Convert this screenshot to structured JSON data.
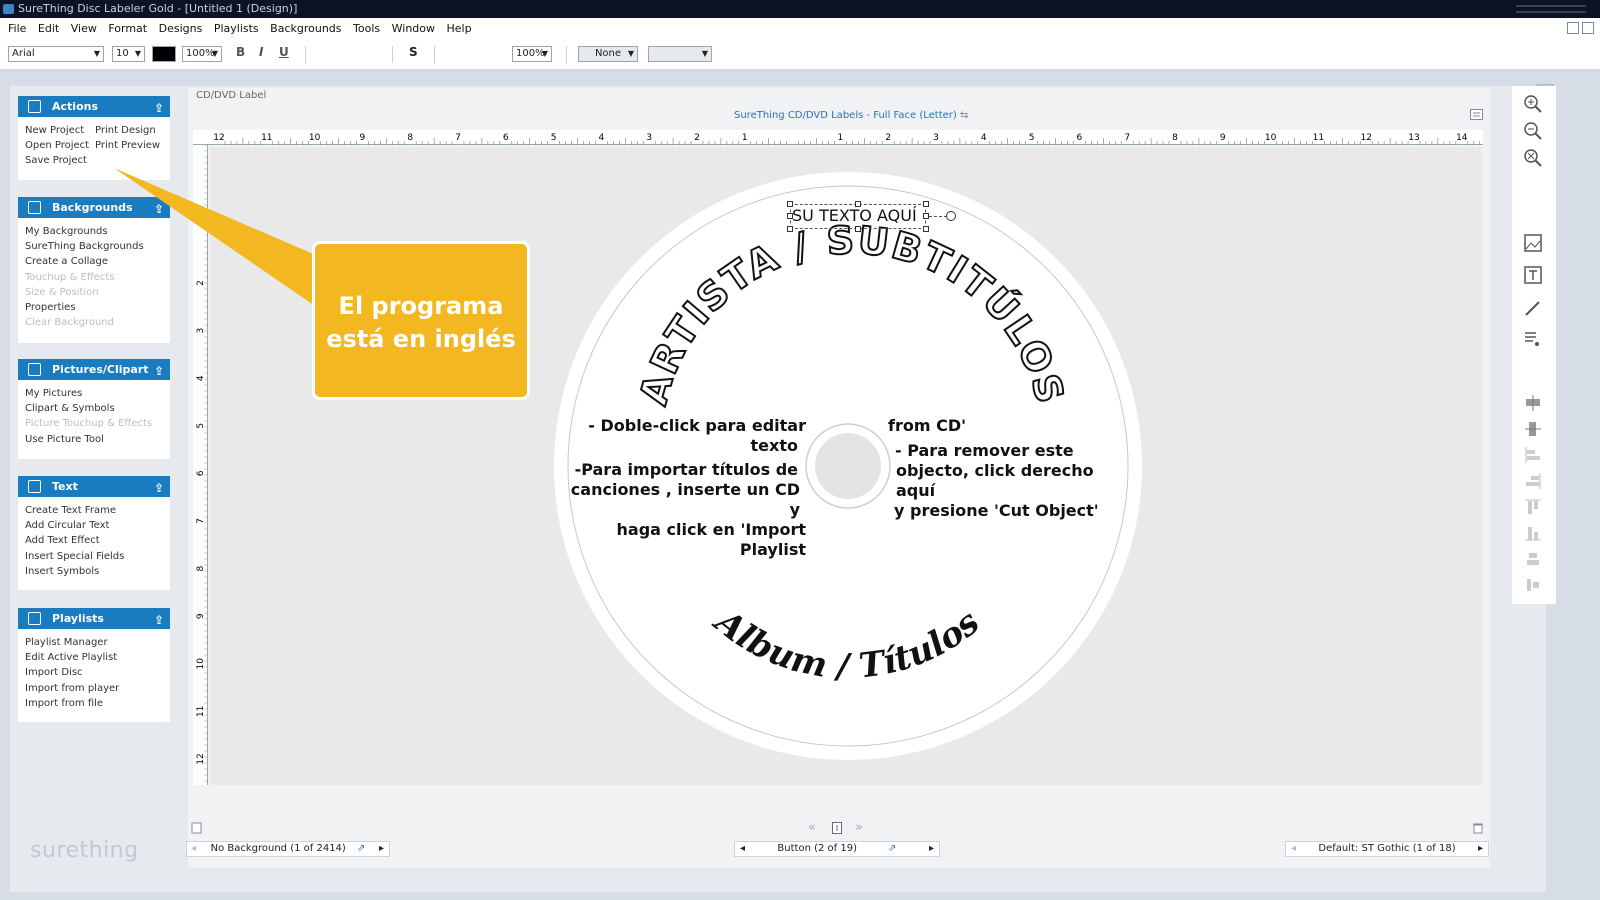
{
  "window": {
    "title": "SureThing Disc Labeler Gold - [Untitled 1 (Design)]"
  },
  "menu": [
    "File",
    "Edit",
    "View",
    "Format",
    "Designs",
    "Playlists",
    "Backgrounds",
    "Tools",
    "Window",
    "Help"
  ],
  "toolbar": {
    "font": "Arial",
    "size": "10",
    "zoom1": "100%",
    "bold": "B",
    "italic": "I",
    "underline": "U",
    "shadow": "S",
    "zoom2": "100%",
    "line": "None",
    "colors": {
      "text": "#000000"
    }
  },
  "panels": {
    "actions": {
      "title": "Actions",
      "col1": [
        "New Project",
        "Open Project",
        "Save Project"
      ],
      "col2": [
        "Print Design",
        "Print Preview"
      ]
    },
    "backgrounds": {
      "title": "Backgrounds",
      "items": [
        {
          "label": "My Backgrounds",
          "enabled": true
        },
        {
          "label": "SureThing Backgrounds",
          "enabled": true
        },
        {
          "label": "Create a Collage",
          "enabled": true
        },
        {
          "label": "Touchup & Effects",
          "enabled": false
        },
        {
          "label": "Size & Position",
          "enabled": false
        },
        {
          "label": "Properties",
          "enabled": true
        },
        {
          "label": "Clear Background",
          "enabled": false
        }
      ]
    },
    "pictures": {
      "title": "Pictures/Clipart",
      "items": [
        {
          "label": "My Pictures",
          "enabled": true
        },
        {
          "label": "Clipart & Symbols",
          "enabled": true
        },
        {
          "label": "Picture Touchup & Effects",
          "enabled": false
        },
        {
          "label": "Use Picture Tool",
          "enabled": true
        }
      ]
    },
    "text": {
      "title": "Text",
      "items": [
        "Create Text Frame",
        "Add Circular Text",
        "Add Text Effect",
        "Insert Special Fields",
        "Insert Symbols"
      ]
    },
    "playlists": {
      "title": "Playlists",
      "items": [
        "Playlist Manager",
        "Edit Active Playlist",
        "Import Disc",
        "Import from player",
        "Import from file"
      ]
    }
  },
  "logo": "surething",
  "document": {
    "tab": "CD/DVD Label",
    "title": "SureThing CD/DVD Labels - Full Face  (Letter)",
    "ruler_h": [
      "12",
      "11",
      "10",
      "9",
      "8",
      "7",
      "6",
      "5",
      "4",
      "3",
      "2",
      "1",
      "",
      "1",
      "2",
      "3",
      "4",
      "5",
      "6",
      "7",
      "8",
      "9",
      "10",
      "11",
      "12",
      "13",
      "14"
    ],
    "ruler_v": [
      "2",
      "3",
      "4",
      "5",
      "6",
      "7",
      "8",
      "9",
      "10",
      "11",
      "12"
    ]
  },
  "disc": {
    "top_text": "SU TEXTO AQUÍ",
    "arc_top": "ARTISTA / SUBTITÚLOS",
    "arc_bottom": "Album / Títulos",
    "left_block": [
      "- Doble-click para editar",
      "texto",
      "-Para importar títulos de",
      "canciones , inserte un CD y",
      "haga click en 'Import Playlist"
    ],
    "right_block": [
      "from CD'",
      "- Para remover este",
      "objecto,  click derecho aquí",
      "y presione 'Cut Object'"
    ]
  },
  "callout": {
    "line1": "El programa",
    "line2": "está en inglés",
    "color": "#f3b722"
  },
  "statusbar": {
    "background": "No Background (1 of 2414)",
    "button": "Button (2 of 19)",
    "font_style": "Default: ST Gothic (1 of 18)"
  }
}
